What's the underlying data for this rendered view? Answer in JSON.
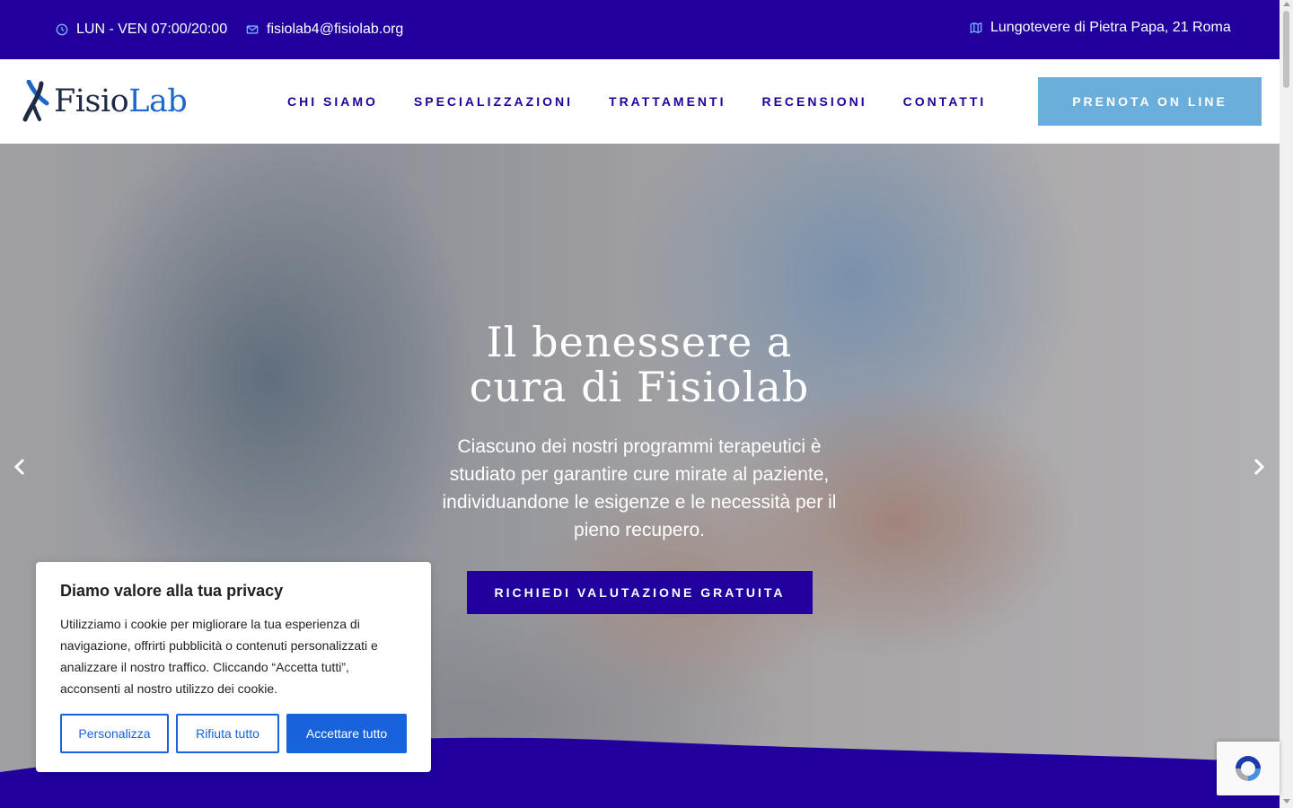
{
  "colors": {
    "primary": "#21009e",
    "accent_light": "#6aafdb",
    "cookie_blue": "#1863dc",
    "logo_dark": "#1f2a44",
    "logo_blue": "#1d67c9"
  },
  "topbar": {
    "hours": {
      "icon": "clock-icon",
      "text": "LUN - VEN 07:00/20:00"
    },
    "email": {
      "icon": "envelope-icon",
      "text": "fisiolab4@fisiolab.org"
    },
    "address": {
      "icon": "map-icon",
      "text": "Lungotevere di Pietra Papa, 21 Roma"
    }
  },
  "header": {
    "logo": {
      "part1": "Fisio",
      "part2": "Lab"
    },
    "nav": [
      {
        "label": "CHI SIAMO"
      },
      {
        "label": "SPECIALIZZAZIONI"
      },
      {
        "label": "TRATTAMENTI"
      },
      {
        "label": "RECENSIONI"
      },
      {
        "label": "CONTATTI"
      }
    ],
    "cta": "PRENOTA ON LINE"
  },
  "hero": {
    "title_line1": "Il benessere a",
    "title_line2": "cura di Fisiolab",
    "subtitle": "Ciascuno dei nostri programmi terapeutici è studiato per garantire cure mirate al paziente, individuandone le esigenze e le necessità per il pieno recupero.",
    "cta": "RICHIEDI VALUTAZIONE GRATUITA",
    "prev_icon": "chevron-left-icon",
    "next_icon": "chevron-right-icon"
  },
  "cookie": {
    "title": "Diamo valore alla tua privacy",
    "text": "Utilizziamo i cookie per migliorare la tua esperienza di navigazione, offrirti pubblicità o contenuti personalizzati e analizzare il nostro traffico. Cliccando “Accetta tutti”, acconsenti al nostro utilizzo dei cookie.",
    "customize": "Personalizza",
    "reject": "Rifiuta tutto",
    "accept": "Accettare tutto"
  }
}
